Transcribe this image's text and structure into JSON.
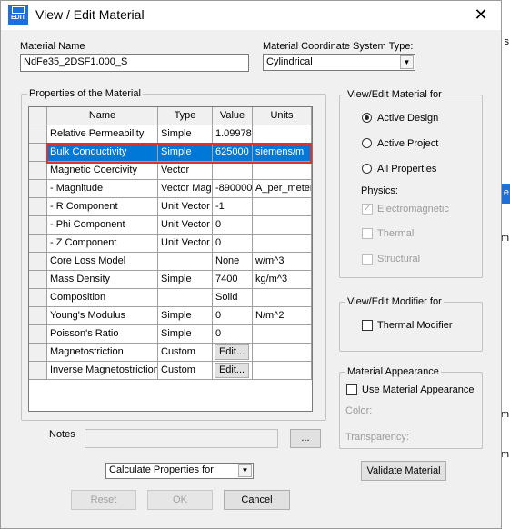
{
  "background": {
    "letters": [
      "s",
      "e",
      "m",
      "m",
      "m"
    ]
  },
  "window": {
    "title": "View / Edit Material",
    "close_glyph": "✕",
    "icon_text": "EDIT"
  },
  "material_name": {
    "label": "Material Name",
    "value": "NdFe35_2DSF1.000_S"
  },
  "coordinate_system": {
    "label": "Material Coordinate System Type:",
    "selected": "Cylindrical"
  },
  "properties": {
    "group_title": "Properties of the Material",
    "columns": [
      "Name",
      "Type",
      "Value",
      "Units"
    ],
    "rows": [
      {
        "name": "Relative Permeability",
        "type": "Simple",
        "value": "1.09978",
        "units": ""
      },
      {
        "name": "Bulk Conductivity",
        "type": "Simple",
        "value": "625000",
        "units": "siemens/m"
      },
      {
        "name": "Magnetic Coercivity",
        "type": "Vector",
        "value": "",
        "units": ""
      },
      {
        "name": "- Magnitude",
        "type": "Vector Mag",
        "value": "-890000",
        "units": "A_per_meter"
      },
      {
        "name": "- R Component",
        "type": "Unit Vector",
        "value": "-1",
        "units": ""
      },
      {
        "name": "- Phi Component",
        "type": "Unit Vector",
        "value": "0",
        "units": ""
      },
      {
        "name": "- Z Component",
        "type": "Unit Vector",
        "value": "0",
        "units": ""
      },
      {
        "name": "Core Loss Model",
        "type": "",
        "value": "None",
        "units": "w/m^3"
      },
      {
        "name": "Mass Density",
        "type": "Simple",
        "value": "7400",
        "units": "kg/m^3"
      },
      {
        "name": "Composition",
        "type": "",
        "value": "Solid",
        "units": ""
      },
      {
        "name": "Young's Modulus",
        "type": "Simple",
        "value": "0",
        "units": "N/m^2"
      },
      {
        "name": "Poisson's Ratio",
        "type": "Simple",
        "value": "0",
        "units": ""
      },
      {
        "name": "Magnetostriction",
        "type": "Custom",
        "value": "Edit...",
        "units": ""
      },
      {
        "name": "Inverse Magnetostriction",
        "type": "Custom",
        "value": "Edit...",
        "units": ""
      }
    ],
    "selected_row": 1
  },
  "view_edit_for": {
    "group_title": "View/Edit Material for",
    "options": [
      "Active Design",
      "Active Project",
      "All Properties"
    ],
    "selected": "Active Design",
    "physics_label": "Physics:",
    "physics": [
      {
        "label": "Electromagnetic",
        "checked": true
      },
      {
        "label": "Thermal",
        "checked": false
      },
      {
        "label": "Structural",
        "checked": false
      }
    ]
  },
  "modifier": {
    "group_title": "View/Edit Modifier for",
    "thermal_label": "Thermal Modifier"
  },
  "appearance": {
    "group_title": "Material Appearance",
    "use_label": "Use Material Appearance",
    "color_label": "Color:",
    "transparency_label": "Transparency:"
  },
  "notes": {
    "label": "Notes",
    "browse_label": "..."
  },
  "calculate": {
    "selected": "Calculate Properties for:"
  },
  "buttons": {
    "validate": "Validate Material",
    "reset": "Reset",
    "ok": "OK",
    "cancel": "Cancel"
  }
}
